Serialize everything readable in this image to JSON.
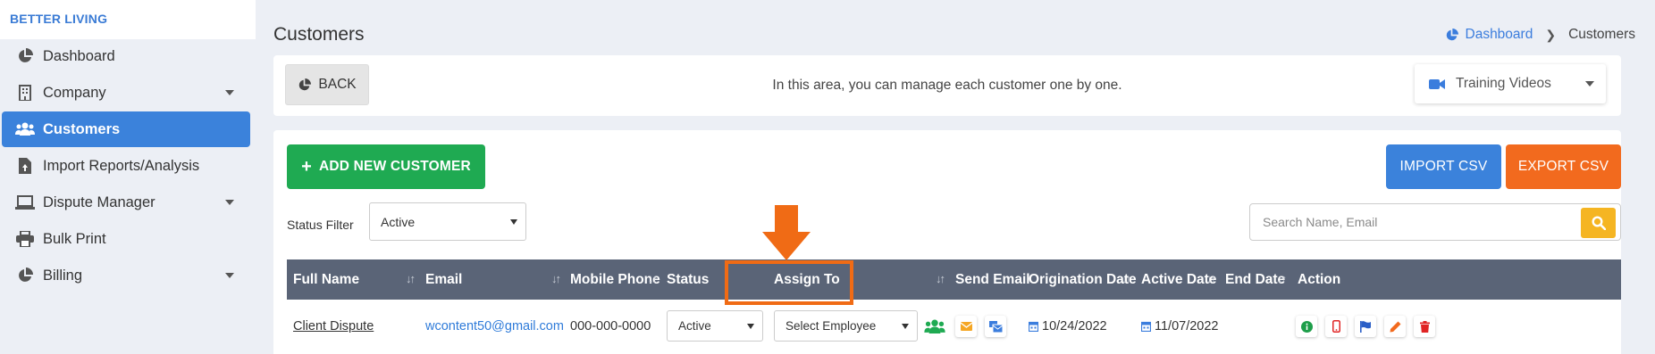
{
  "brand": "BETTER LIVING",
  "sidebar": {
    "items": [
      {
        "label": "Dashboard",
        "icon": "pie-chart-icon",
        "has_submenu": false
      },
      {
        "label": "Company",
        "icon": "building-icon",
        "has_submenu": true
      },
      {
        "label": "Customers",
        "icon": "users-icon",
        "has_submenu": false,
        "active": true
      },
      {
        "label": "Import Reports/Analysis",
        "icon": "file-import-icon",
        "has_submenu": false
      },
      {
        "label": "Dispute Manager",
        "icon": "laptop-icon",
        "has_submenu": true
      },
      {
        "label": "Bulk Print",
        "icon": "printer-icon",
        "has_submenu": false
      },
      {
        "label": "Billing",
        "icon": "pie-chart-icon",
        "has_submenu": true
      }
    ]
  },
  "header": {
    "title": "Customers",
    "breadcrumb": {
      "home": "Dashboard",
      "current": "Customers"
    }
  },
  "infobar": {
    "back_label": "BACK",
    "message": "In this area, you can manage each customer one by one.",
    "training_label": "Training Videos"
  },
  "toolbar": {
    "add_label": "ADD NEW CUSTOMER",
    "import_label": "IMPORT CSV",
    "export_label": "EXPORT CSV",
    "status_filter_label": "Status Filter",
    "status_filter_value": "Active",
    "search_placeholder": "Search Name, Email"
  },
  "table": {
    "headers": {
      "full_name": "Full Name",
      "email": "Email",
      "mobile_phone": "Mobile Phone",
      "status": "Status",
      "assign_to": "Assign To",
      "send_email": "Send Email",
      "origination_date": "Origination Date",
      "active_date": "Active Date",
      "end_date": "End Date",
      "action": "Action"
    },
    "rows": [
      {
        "full_name": "Client Dispute",
        "email": "wcontent50@gmail.com",
        "mobile_phone": "000-000-0000",
        "status": "Active",
        "assign_to": "Select Employee",
        "origination_date": "10/24/2022",
        "active_date": "11/07/2022",
        "end_date": ""
      }
    ]
  },
  "colors": {
    "primary": "#3b82db",
    "success": "#1faa52",
    "warning": "#f26a1e",
    "search": "#f5b522",
    "table_header": "#5a6477",
    "annotation": "#f06b15"
  }
}
